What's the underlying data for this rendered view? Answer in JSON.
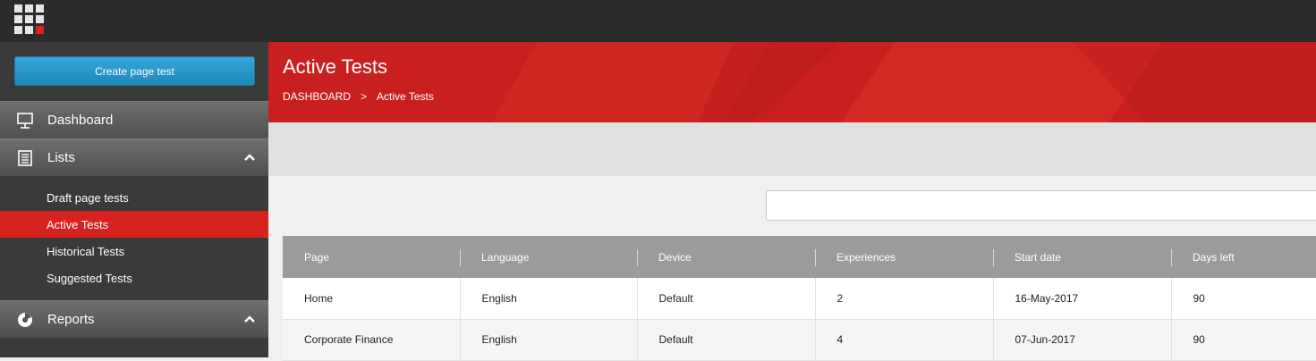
{
  "sidebar": {
    "create_button": "Create page test",
    "dashboard": "Dashboard",
    "lists": "Lists",
    "list_items": [
      "Draft page tests",
      "Active Tests",
      "Historical Tests",
      "Suggested Tests"
    ],
    "reports": "Reports"
  },
  "header": {
    "title": "Active Tests",
    "breadcrumb": [
      "DASHBOARD",
      "Active Tests"
    ],
    "breadcrumb_separator": ">"
  },
  "search": {
    "placeholder": ""
  },
  "table": {
    "columns": [
      "Page",
      "Language",
      "Device",
      "Experiences",
      "Start date",
      "Days left"
    ],
    "rows": [
      [
        "Home",
        "English",
        "Default",
        "2",
        "16-May-2017",
        "90"
      ],
      [
        "Corporate Finance",
        "English",
        "Default",
        "4",
        "07-Jun-2017",
        "90"
      ]
    ]
  },
  "colors": {
    "accent": "#d7231f",
    "sidebar_bg": "#3a3a3a",
    "topbar_bg": "#2b2b2b",
    "button": "#2a98c9"
  },
  "icons": [
    "app-grid-icon",
    "presentation-board-icon",
    "list-icon",
    "chevron-up-icon",
    "pie-chart-icon"
  ]
}
